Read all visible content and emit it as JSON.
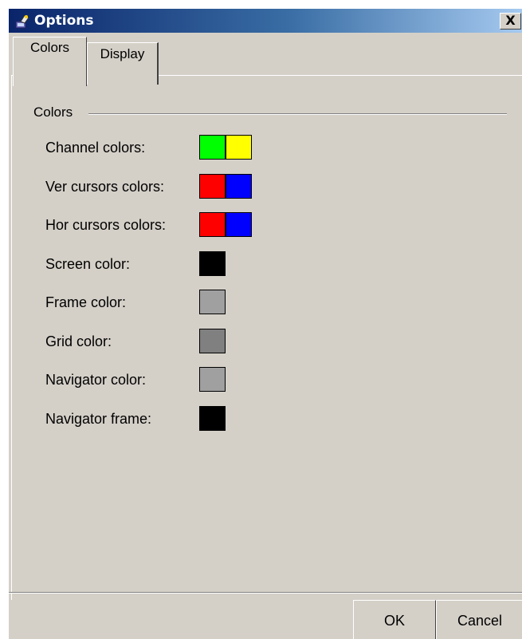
{
  "window": {
    "title": "Options",
    "close_glyph": "X",
    "icon": "app-icon"
  },
  "tabs": [
    {
      "label": "Colors",
      "selected": true
    },
    {
      "label": "Display",
      "selected": false
    }
  ],
  "group": {
    "label": "Colors"
  },
  "settings": [
    {
      "label": "Channel colors:",
      "colors": [
        "#00ff00",
        "#ffff00"
      ]
    },
    {
      "label": "Ver cursors colors:",
      "colors": [
        "#ff0000",
        "#0000ff"
      ]
    },
    {
      "label": "Hor cursors colors:",
      "colors": [
        "#ff0000",
        "#0000ff"
      ]
    },
    {
      "label": "Screen color:",
      "colors": [
        "#000000"
      ]
    },
    {
      "label": "Frame color:",
      "colors": [
        "#a0a0a0"
      ]
    },
    {
      "label": "Grid color:",
      "colors": [
        "#808080"
      ]
    },
    {
      "label": "Navigator color:",
      "colors": [
        "#a0a0a0"
      ]
    },
    {
      "label": "Navigator frame:",
      "colors": [
        "#000000"
      ]
    }
  ],
  "buttons": {
    "ok": "OK",
    "cancel": "Cancel"
  }
}
